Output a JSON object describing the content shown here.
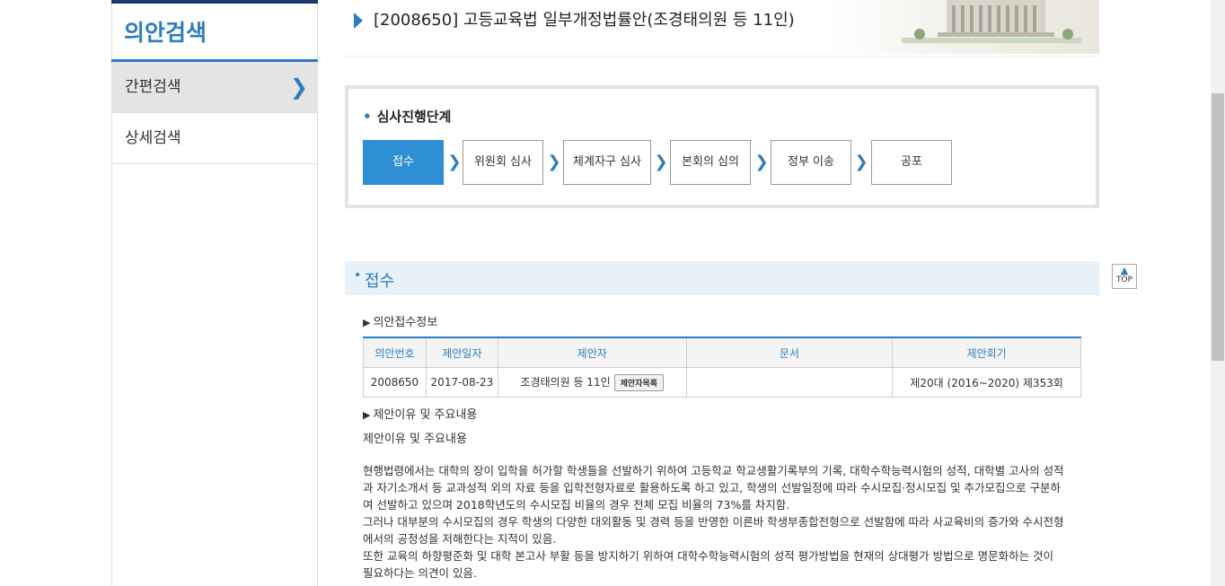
{
  "sidebar": {
    "title": "의안검색",
    "items": [
      {
        "label": "간편검색"
      },
      {
        "label": "상세검색"
      }
    ]
  },
  "bill": {
    "title": "[2008650] 고등교육법 일부개정법률안(조경태의원 등 11인)"
  },
  "progress": {
    "heading": "심사진행단계",
    "steps": [
      {
        "label": "접수"
      },
      {
        "label": "위원회 심사"
      },
      {
        "label": "체계자구 심사"
      },
      {
        "label": "본회의 심의"
      },
      {
        "label": "정부 이송"
      },
      {
        "label": "공포"
      }
    ],
    "active_step": "접수"
  },
  "section": {
    "title": "접수",
    "receipt_info_heading": "의안접수정보",
    "table": {
      "headers": [
        "의안번호",
        "제안일자",
        "제안자",
        "문서",
        "제안회기"
      ],
      "row": {
        "bill_no": "2008650",
        "date": "2017-08-23",
        "proposer": "조경태의원 등 11인",
        "proposer_button": "제안자목록",
        "document": "",
        "session": "제20대 (2016~2020) 제353회"
      }
    },
    "reason_heading": "제안이유 및 주요내용",
    "reason_subtitle": "제안이유 및 주요내용",
    "body_lines": [
      "현행법령에서는 대학의 장이 입학을 허가할 학생들을 선발하기 위하여 고등학교 학교생활기록부의 기록, 대학수학능력시험의 성적, 대학별 고사의 성적",
      "과 자기소개서 등 교과성적 외의 자료 등을 입학전형자료로 활용하도록 하고 있고, 학생의 선발일정에 따라 수시모집·정시모집 및 추가모집으로 구분하",
      "여 선발하고 있으며 2018학년도의 수시모집 비율의 경우 전체 모집 비율의 73%를 차지함.",
      "그러나 대부분의 수시모집의 경우 학생의 다양한 대외활동 및 경력 등을 반영한 이른바 학생부종합전형으로 선발함에 따라 사교육비의 증가와 수시전형",
      "에서의 공정성을 저해한다는 지적이 있음.",
      "또한 교육의 하향평준화 및 대학 본고사 부활 등을 방지하기 위하여 대학수학능력시험의 성적 평가방법을 현재의 상대평가 방법으로 명문화하는 것이",
      "필요하다는 의견이 있음."
    ]
  },
  "top_button": {
    "label": "TOP",
    "icon": "arrow-up-icon"
  },
  "colors": {
    "accent": "#2b7cc2",
    "active_step": "#2f8fd4",
    "navy": "#1b3a6b"
  }
}
